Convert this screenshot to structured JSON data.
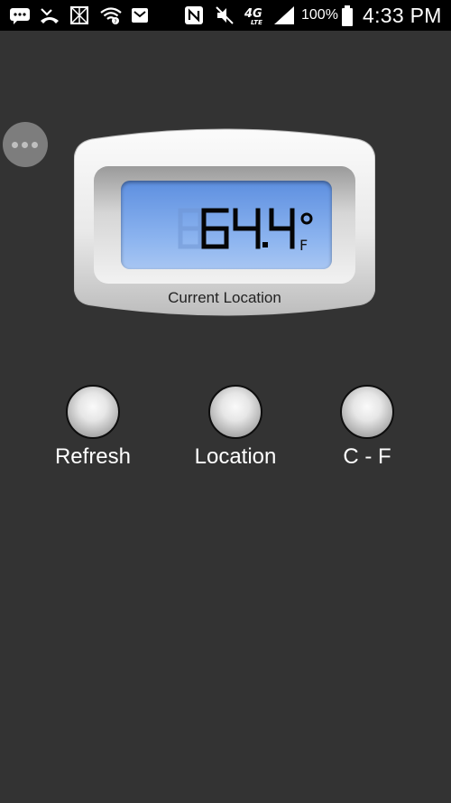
{
  "status_bar": {
    "battery_percent": "100%",
    "time": "4:33 PM",
    "network": "4G LTE",
    "icons": [
      "message-icon",
      "missed-call-icon",
      "gallery-icon",
      "wifi-icon",
      "email-icon",
      "nfc-icon",
      "mute-icon",
      "4g-lte-icon",
      "signal-icon",
      "battery-icon"
    ]
  },
  "thermometer": {
    "temperature": "64.4",
    "unit": "F",
    "degree_symbol": "°",
    "location_label": "Current Location"
  },
  "buttons": [
    {
      "label": "Refresh"
    },
    {
      "label": "Location"
    },
    {
      "label": "C - F"
    }
  ],
  "colors": {
    "background": "#333333",
    "lcd_top": "#5d8fe0",
    "lcd_bottom": "#a8c6f2",
    "status_bar": "#000000"
  }
}
